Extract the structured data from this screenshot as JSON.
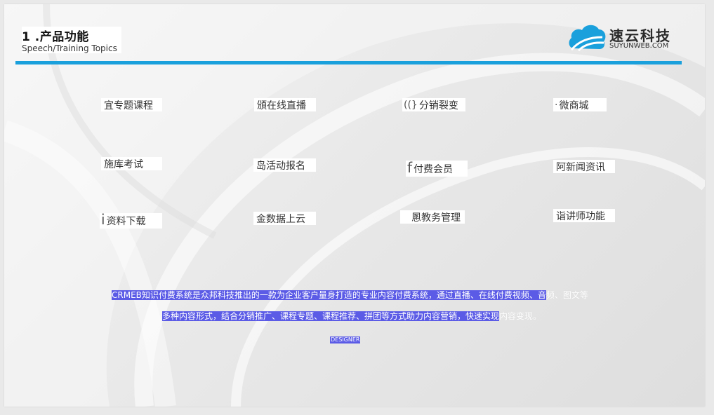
{
  "header": {
    "title": "1 .产品功能",
    "subtitle": "Speech/Training Topics"
  },
  "logo": {
    "name": "速云科技",
    "domain": "SUYUNWEB.COM",
    "icon": "cloud-logo-icon",
    "color": "#1aa0dc"
  },
  "accent_color": "#1aa0dc",
  "features": [
    {
      "glyph": "",
      "label": "宜专题课程"
    },
    {
      "glyph": "",
      "label": "頒在线直播"
    },
    {
      "glyph": "((}",
      "label": "分销裂变"
    },
    {
      "glyph": "·",
      "label": "微商城"
    },
    {
      "glyph": "",
      "label": "施库考试"
    },
    {
      "glyph": "",
      "label": "岛活动报名"
    },
    {
      "glyph": "f",
      "label": "付费会员"
    },
    {
      "glyph": "",
      "label": "阿新闻资讯"
    },
    {
      "glyph": "i",
      "label": "资料下载"
    },
    {
      "glyph": "",
      "label": "金数据上云"
    },
    {
      "glyph": "",
      "label": "慁教务管理"
    },
    {
      "glyph": "",
      "label": "诣讲师功能"
    }
  ],
  "description": {
    "line1_highlight": "CRMEB知识付费系统是众邦科技推出的一款为企业客户量身打造的专业内容付费系统，通过直播、在线付费视频、音",
    "line1_rest": "频、图文等",
    "line2_highlight": "多种内容形式，结合分销推广、课程专题、课程推荐、拼团等方式助力内容营销，快速实现",
    "line2_rest": "内容变现。",
    "highlight_color": "#5b5be6"
  },
  "footer": {
    "designer": "DESIGNER"
  }
}
